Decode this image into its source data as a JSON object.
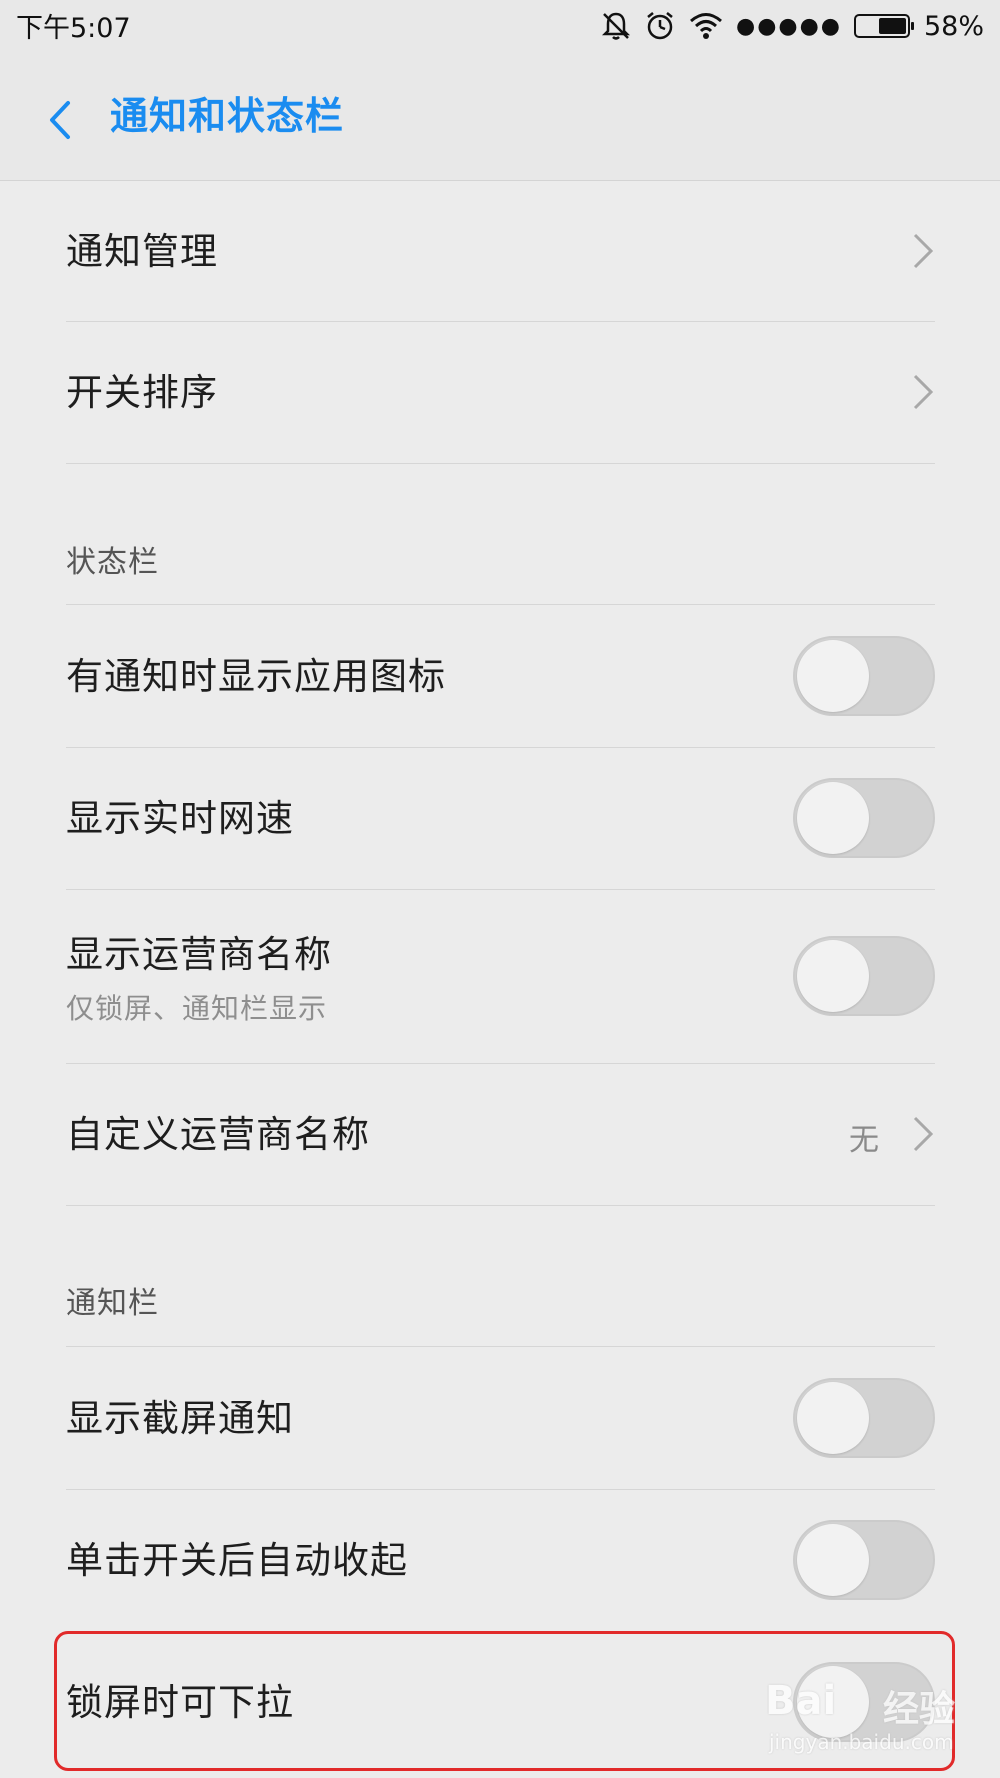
{
  "status_bar": {
    "time": "下午5:07",
    "signal_dots": "●●●●●",
    "battery_percent": "58%",
    "battery_level": 0.58
  },
  "header": {
    "title": "通知和状态栏",
    "accent_color": "#1a8cf0"
  },
  "rows": {
    "notify_manage": {
      "label": "通知管理"
    },
    "switch_order": {
      "label": "开关排序"
    },
    "show_app_icon": {
      "label": "有通知时显示应用图标",
      "enabled": false
    },
    "show_net_speed": {
      "label": "显示实时网速",
      "enabled": false
    },
    "show_carrier": {
      "label": "显示运营商名称",
      "sublabel": "仅锁屏、通知栏显示",
      "enabled": false
    },
    "custom_carrier": {
      "label": "自定义运营商名称",
      "value": "无"
    },
    "show_screenshot_notify": {
      "label": "显示截屏通知",
      "enabled": false
    },
    "auto_collapse": {
      "label": "单击开关后自动收起",
      "enabled": false
    },
    "pull_down_lockscreen": {
      "label": "锁屏时可下拉",
      "enabled": false
    }
  },
  "sections": {
    "status_bar": "状态栏",
    "notification_bar": "通知栏"
  },
  "watermark": {
    "brand": "Bai",
    "brand2": "经验",
    "url": "jingyan.baidu.com"
  },
  "highlight_color": "#e12a2a"
}
